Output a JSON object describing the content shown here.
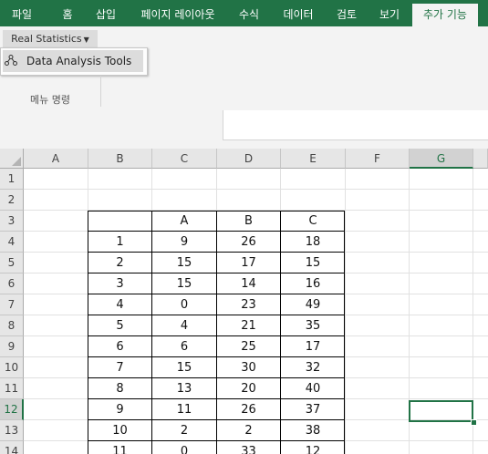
{
  "ribbon_tabs": [
    "파일",
    "홈",
    "삽입",
    "페이지 레이아웃",
    "수식",
    "데이터",
    "검토",
    "보기",
    "추가 기능"
  ],
  "active_tab": "추가 기능",
  "colors": {
    "accent": "#217346"
  },
  "addin": {
    "button_label": "Real Statistics",
    "menu_item_label": "Data Analysis Tools",
    "menu_item_icon": "hierarchy-icon",
    "group_label": "메뉴 명령"
  },
  "sheet": {
    "columns": [
      "A",
      "B",
      "C",
      "D",
      "E",
      "F",
      "G"
    ],
    "selected_column": "G",
    "rows": [
      "1",
      "2",
      "3",
      "4",
      "5",
      "6",
      "7",
      "8",
      "9",
      "10",
      "11",
      "12",
      "13",
      "14"
    ],
    "selected_row": "12",
    "active_cell": "G12"
  },
  "table": {
    "headers": [
      "",
      "A",
      "B",
      "C"
    ],
    "rows": [
      [
        "1",
        "9",
        "26",
        "18"
      ],
      [
        "2",
        "15",
        "17",
        "15"
      ],
      [
        "3",
        "15",
        "14",
        "16"
      ],
      [
        "4",
        "0",
        "23",
        "49"
      ],
      [
        "5",
        "4",
        "21",
        "35"
      ],
      [
        "6",
        "6",
        "25",
        "17"
      ],
      [
        "7",
        "15",
        "30",
        "32"
      ],
      [
        "8",
        "13",
        "20",
        "40"
      ],
      [
        "9",
        "11",
        "26",
        "37"
      ],
      [
        "10",
        "2",
        "2",
        "38"
      ],
      [
        "11",
        "0",
        "33",
        "12"
      ]
    ]
  }
}
